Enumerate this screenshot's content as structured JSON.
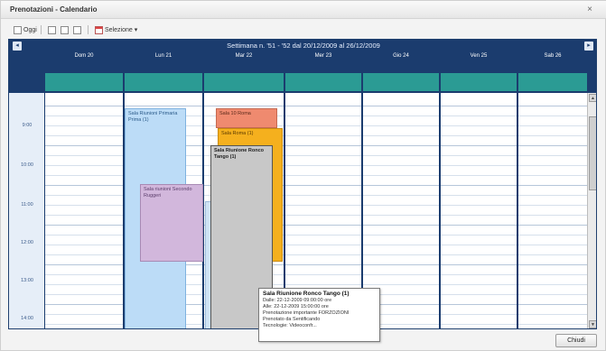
{
  "window": {
    "title": "Prenotazioni - Calendario",
    "close_label": "×"
  },
  "toolbar": {
    "oggi_label": "Oggi",
    "selection_label": "Selezione ▾"
  },
  "calendar": {
    "prev_label": "◂",
    "next_label": "▸",
    "range_title": "Settimana n. '51 - '52  dal 20/12/2009 al 26/12/2009",
    "days": [
      "Dom 20",
      "Lun 21",
      "Mar 22",
      "Mer 23",
      "Gio 24",
      "Ven 25",
      "Sab 26"
    ],
    "hours": [
      "9:00",
      "10:00",
      "11:00",
      "12:00",
      "13:00",
      "14:00"
    ],
    "events": {
      "lun_blue": "Sala Riunioni Primaria Prima (1)",
      "lun_purple": "Sala riunioni Secondo Ruggeri",
      "mar_salmon": "Sala 10 Roma",
      "mar_orange": "Sala Roma (1)",
      "mar_gray": "Sala Riunione Ronco Tango (1)"
    },
    "colors": {
      "navy": "#1b3c6e",
      "teal": "#2b9b94",
      "blue": "#bcdcf7",
      "purple": "#d2b7dc",
      "salmon": "#ef8a6f",
      "orange": "#f5b01e",
      "gray": "#c8c8c8"
    }
  },
  "tooltip": {
    "title": "Sala Riunione Ronco Tango (1)",
    "lines": [
      "Dalle: 22-12-2009 09:00:00 ore",
      "Alle: 22-12-2009 15:00:00 ore",
      "Prenotazione importante FORZOZIONI",
      "Prenotato da Sentificando",
      "Tecnologie: Videoconfr..."
    ]
  },
  "footer": {
    "close_button": "Chiudi"
  }
}
